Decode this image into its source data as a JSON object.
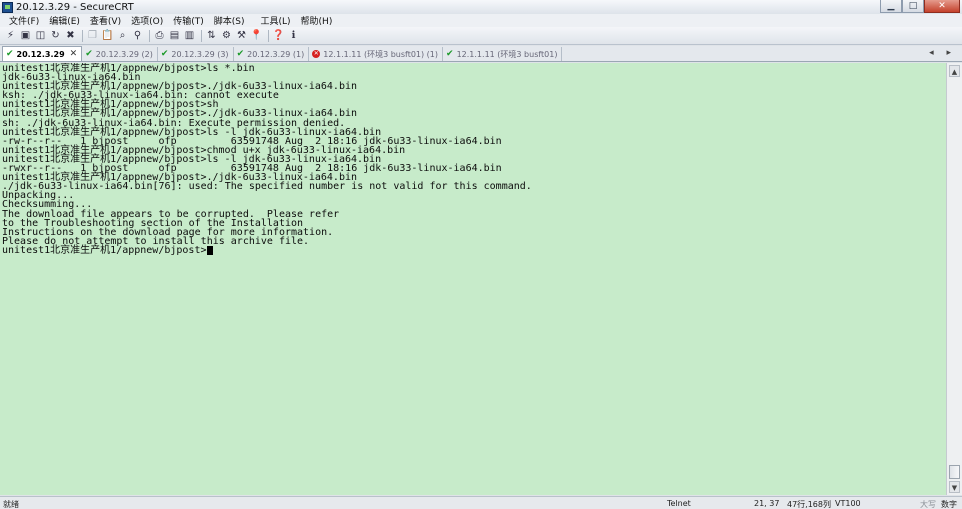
{
  "window": {
    "title": "20.12.3.29 - SecureCRT",
    "controls": {
      "minimize": "▁",
      "maximize": "□",
      "close": "✕"
    }
  },
  "menu": [
    "文件(F)",
    "编辑(E)",
    "查看(V)",
    "选项(O)",
    "传输(T)",
    "脚本(S)",
    "工具(L)",
    "帮助(H)"
  ],
  "tabs": [
    {
      "label": "20.12.3.29",
      "status": "connected",
      "active": true
    },
    {
      "label": "20.12.3.29 (2)",
      "status": "connected",
      "active": false
    },
    {
      "label": "20.12.3.29 (3)",
      "status": "connected",
      "active": false
    },
    {
      "label": "20.12.3.29 (1)",
      "status": "connected",
      "active": false
    },
    {
      "label": "12.1.1.11 (环境3 busft01) (1)",
      "status": "disconnected",
      "active": false
    },
    {
      "label": "12.1.1.11 (环境3 busft01)",
      "status": "connected",
      "active": false
    }
  ],
  "tab_close_glyph": "✕",
  "tab_scroll_glyphs": "◂ ▸",
  "terminal": {
    "background": "#c7ebca",
    "lines": [
      "unitest1北京准生产机1/appnew/bjpost>ls *.bin",
      "jdk-6u33-linux-ia64.bin",
      "unitest1北京准生产机1/appnew/bjpost>./jdk-6u33-linux-ia64.bin",
      "ksh: ./jdk-6u33-linux-ia64.bin: cannot execute",
      "unitest1北京准生产机1/appnew/bjpost>sh",
      "unitest1北京准生产机1/appnew/bjpost>./jdk-6u33-linux-ia64.bin",
      "sh: ./jdk-6u33-linux-ia64.bin: Execute permission denied.",
      "unitest1北京准生产机1/appnew/bjpost>ls -l jdk-6u33-linux-ia64.bin",
      "-rw-r--r--   1 bjpost     ofp         63591748 Aug  2 18:16 jdk-6u33-linux-ia64.bin",
      "unitest1北京准生产机1/appnew/bjpost>chmod u+x jdk-6u33-linux-ia64.bin",
      "unitest1北京准生产机1/appnew/bjpost>ls -l jdk-6u33-linux-ia64.bin",
      "-rwxr--r--   1 bjpost     ofp         63591748 Aug  2 18:16 jdk-6u33-linux-ia64.bin",
      "unitest1北京准生产机1/appnew/bjpost>./jdk-6u33-linux-ia64.bin",
      "./jdk-6u33-linux-ia64.bin[76]: used: The specified number is not valid for this command.",
      "Unpacking...",
      "Checksumming...",
      "The download file appears to be corrupted.  Please refer",
      "to the Troubleshooting section of the Installation",
      "Instructions on the download page for more information.",
      "Please do not attempt to install this archive file."
    ],
    "prompt": "unitest1北京准生产机1/appnew/bjpost>"
  },
  "status": {
    "ready": "就绪",
    "protocol": "Telnet",
    "cursor_pos": "21, 37",
    "size": "47行,168列",
    "emulation": "VT100",
    "caps": "大写",
    "num": "数字"
  }
}
